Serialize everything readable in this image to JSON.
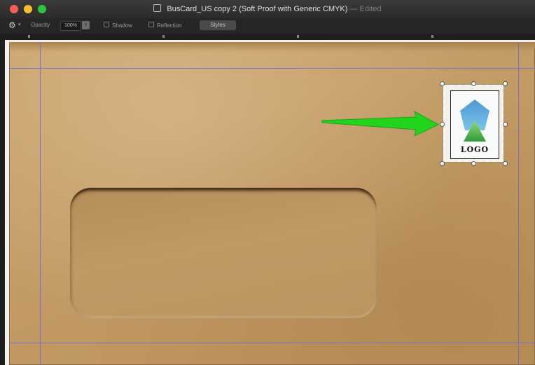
{
  "window": {
    "title": "BusCard_US copy 2 (Soft Proof with Generic CMYK)",
    "edited_label": "— Edited"
  },
  "toolbar": {
    "opacity_label": "Opacity",
    "opacity_value": "100%",
    "shadow_label": "Shadow",
    "reflection_label": "Reflection",
    "styles_label": "Styles"
  },
  "canvas": {
    "logo_text": "LOGO"
  },
  "colors": {
    "arrow": "#22d41c",
    "guides": "#6a6ad8",
    "envelope": "#c39b66"
  },
  "icons": [
    "gear-icon",
    "arrow-icon",
    "pentagon-logo-icon"
  ]
}
